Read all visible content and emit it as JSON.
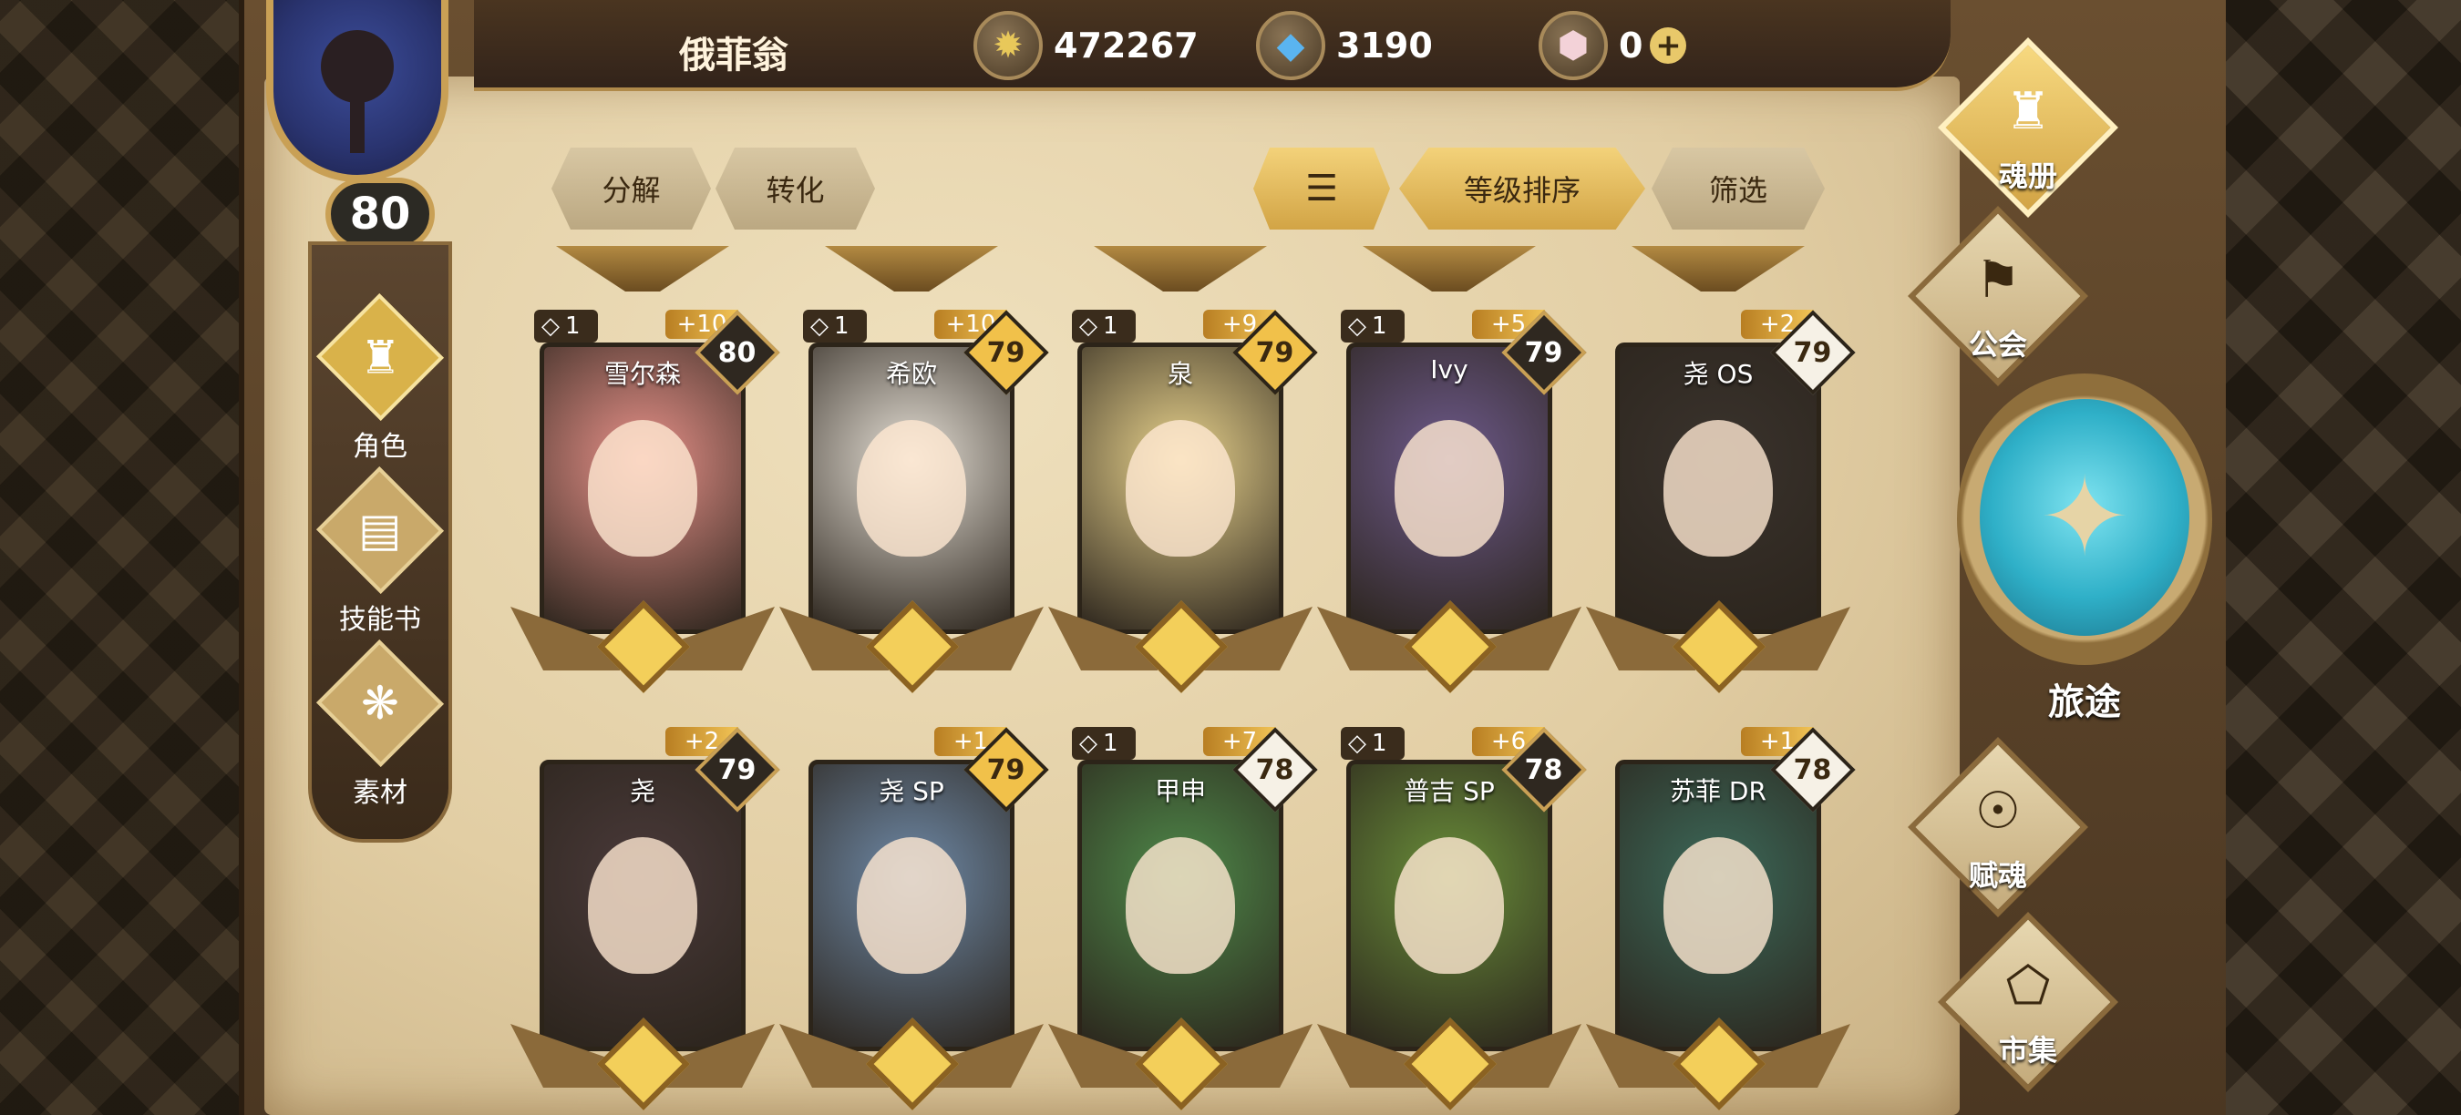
{
  "player": {
    "name": "俄菲翁",
    "level": "80"
  },
  "currencies": [
    {
      "icon": "gold-coin-icon",
      "value": "472267"
    },
    {
      "icon": "blue-crystal-icon",
      "value": "3190"
    },
    {
      "icon": "pink-gem-icon",
      "value": "0"
    }
  ],
  "left_nav": [
    {
      "label": "角色",
      "icon": "character-icon",
      "active": true
    },
    {
      "label": "技能书",
      "icon": "skill-book-icon",
      "active": false
    },
    {
      "label": "素材",
      "icon": "material-icon",
      "active": false
    }
  ],
  "toolbar": {
    "decompose": "分解",
    "convert": "转化",
    "sort_label": "等级排序",
    "filter": "筛选"
  },
  "cards": [
    {
      "name": "雪尔森",
      "stars": "1",
      "plus": "+10",
      "level": "80",
      "lvl_style": "dark"
    },
    {
      "name": "希欧",
      "stars": "1",
      "plus": "+10",
      "level": "79",
      "lvl_style": "gold"
    },
    {
      "name": "泉",
      "stars": "1",
      "plus": "+9",
      "level": "79",
      "lvl_style": "gold"
    },
    {
      "name": "Ivy",
      "stars": "1",
      "plus": "+5",
      "level": "79",
      "lvl_style": "dark"
    },
    {
      "name": "尧 OS",
      "stars": "",
      "plus": "+2",
      "level": "79",
      "lvl_style": "light"
    },
    {
      "name": "尧",
      "stars": "",
      "plus": "+2",
      "level": "79",
      "lvl_style": "dark"
    },
    {
      "name": "尧 SP",
      "stars": "",
      "plus": "+1",
      "level": "79",
      "lvl_style": "gold"
    },
    {
      "name": "甲申",
      "stars": "1",
      "plus": "+7",
      "level": "78",
      "lvl_style": "light"
    },
    {
      "name": "普吉 SP",
      "stars": "1",
      "plus": "+6",
      "level": "78",
      "lvl_style": "dark"
    },
    {
      "name": "苏菲 DR",
      "stars": "",
      "plus": "+1",
      "level": "78",
      "lvl_style": "light"
    }
  ],
  "card_colors": [
    "#e9928a",
    "#e6e0d6",
    "#e9d38d",
    "#6e5a8c",
    "#3a332d",
    "#4a3a3a",
    "#6f8aa8",
    "#4f8a4a",
    "#6a8f3a",
    "#3c6a5a"
  ],
  "right_nav": [
    {
      "label": "魂册",
      "icon": "soul-book-icon",
      "active": true
    },
    {
      "label": "公会",
      "icon": "guild-icon",
      "active": false
    },
    {
      "label": "旅途",
      "icon": "journey-icon",
      "active": false
    },
    {
      "label": "赋魂",
      "icon": "soul-infuse-icon",
      "active": false
    },
    {
      "label": "市集",
      "icon": "market-icon",
      "active": false
    }
  ]
}
